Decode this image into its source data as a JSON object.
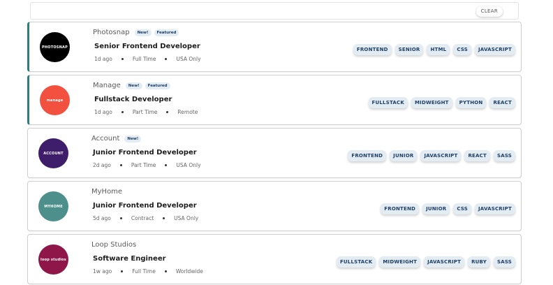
{
  "filter": {
    "clear_label": "CLEAR"
  },
  "jobs": [
    {
      "logo_text": "PHOTOSNAP",
      "logo_color": "#000000",
      "company": "Photosnap",
      "new": "New!",
      "featured": "Featured",
      "position": "Senior Frontend Developer",
      "posted": "1d ago",
      "contract": "Full Time",
      "location": "USA Only",
      "tags": [
        "FRONTEND",
        "SENIOR",
        "HTML",
        "CSS",
        "JAVASCRIPT"
      ]
    },
    {
      "logo_text": "manage",
      "logo_color": "#f2513f",
      "company": "Manage",
      "new": "New!",
      "featured": "Featured",
      "position": "Fullstack Developer",
      "posted": "1d ago",
      "contract": "Part Time",
      "location": "Remote",
      "tags": [
        "FULLSTACK",
        "MIDWEIGHT",
        "PYTHON",
        "REACT"
      ]
    },
    {
      "logo_text": "ACCOUNT",
      "logo_color": "#3e1d6b",
      "company": "Account",
      "new": "New!",
      "position": "Junior Frontend Developer",
      "posted": "2d ago",
      "contract": "Part Time",
      "location": "USA Only",
      "tags": [
        "FRONTEND",
        "JUNIOR",
        "JAVASCRIPT",
        "REACT",
        "SASS"
      ]
    },
    {
      "logo_text": "MYHOME",
      "logo_color": "#4d8f8a",
      "company": "MyHome",
      "position": "Junior Frontend Developer",
      "posted": "5d ago",
      "contract": "Contract",
      "location": "USA Only",
      "tags": [
        "FRONTEND",
        "JUNIOR",
        "CSS",
        "JAVASCRIPT"
      ]
    },
    {
      "logo_text": "loop studios",
      "logo_color": "#8e1649",
      "company": "Loop Studios",
      "position": "Software Engineer",
      "posted": "1w ago",
      "contract": "Full Time",
      "location": "Worldwide",
      "tags": [
        "FULLSTACK",
        "MIDWEIGHT",
        "JAVASCRIPT",
        "RUBY",
        "SASS"
      ]
    }
  ]
}
